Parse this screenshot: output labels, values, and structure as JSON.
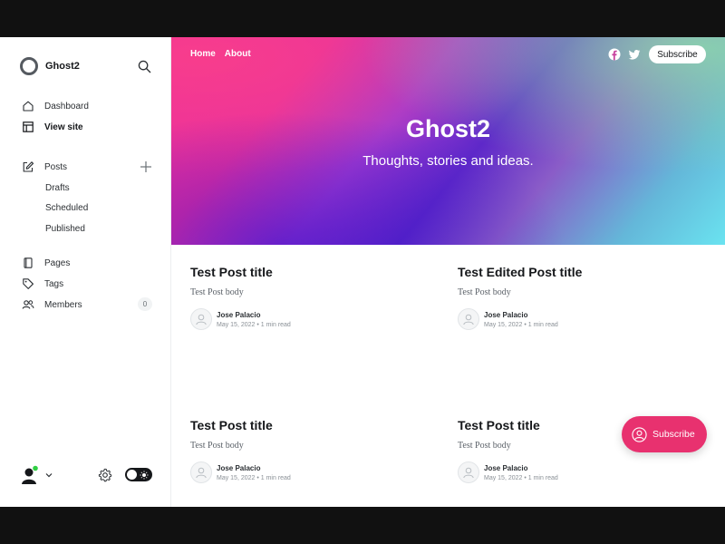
{
  "sidebar": {
    "site_name": "Ghost2",
    "nav": {
      "dashboard": "Dashboard",
      "view_site": "View site",
      "posts": "Posts",
      "drafts": "Drafts",
      "scheduled": "Scheduled",
      "published": "Published",
      "pages": "Pages",
      "tags": "Tags",
      "members": "Members",
      "members_count": "0"
    },
    "icons": [
      "home-icon",
      "layout-icon",
      "edit-icon",
      "plus-icon",
      "page-icon",
      "tag-icon",
      "members-icon",
      "search-icon",
      "gear-icon",
      "chevron-down-icon"
    ]
  },
  "site": {
    "nav": {
      "home": "Home",
      "about": "About"
    },
    "subscribe_label": "Subscribe",
    "title": "Ghost2",
    "description": "Thoughts, stories and ideas.",
    "social_icons": [
      "facebook-icon",
      "twitter-icon"
    ]
  },
  "posts": [
    {
      "title": "Test Post title",
      "excerpt": "Test Post body",
      "author": "Jose Palacio",
      "meta": "May 15, 2022  •  1 min read"
    },
    {
      "title": "Test Edited Post title",
      "excerpt": "Test Post body",
      "author": "Jose Palacio",
      "meta": "May 15, 2022  •  1 min read"
    },
    {
      "title": "Test Post title",
      "excerpt": "Test Post body",
      "author": "Jose Palacio",
      "meta": "May 15, 2022  •  1 min read"
    },
    {
      "title": "Test Post title",
      "excerpt": "Test Post body",
      "author": "Jose Palacio",
      "meta": "May 15, 2022  •  1 min read"
    }
  ],
  "portal": {
    "label": "Subscribe"
  },
  "colors": {
    "accent": "#e8316f",
    "dark": "#15171a",
    "online": "#30cf43"
  }
}
